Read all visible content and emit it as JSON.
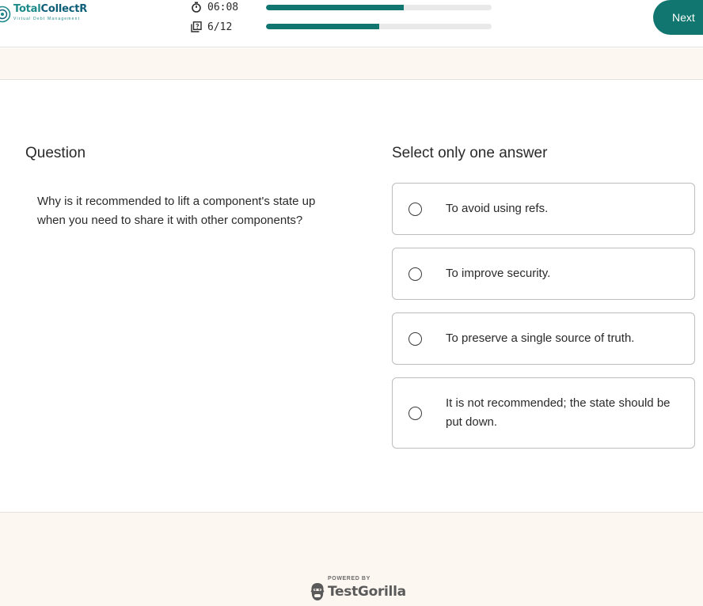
{
  "header": {
    "logo": {
      "name_part1": "Total",
      "name_part2": "CollectR",
      "tagline": "Virtual Debt Management"
    },
    "timer": {
      "icon": "stopwatch-icon",
      "value": "06:08",
      "progress": 0.61
    },
    "question_count": {
      "icon": "question-book-icon",
      "value": "6/12",
      "progress": 0.5
    },
    "next_label": "Next"
  },
  "question": {
    "heading": "Question",
    "text": "Why is it recommended to lift a component's state up when you need to share it with other components?"
  },
  "answers": {
    "heading": "Select only one answer",
    "options": [
      {
        "label": "To avoid using refs.",
        "selected": false
      },
      {
        "label": "To improve security.",
        "selected": false
      },
      {
        "label": "To preserve a single source of truth.",
        "selected": false
      },
      {
        "label": "It is not recommended; the state should be put down.",
        "selected": false
      }
    ]
  },
  "footer": {
    "powered_by": "POWERED BY",
    "brand": "TestGorilla",
    "brand_icon": "gorilla-icon"
  },
  "colors": {
    "accent": "#11766f",
    "band": "#fdf7f2",
    "track": "#e9e9e9"
  }
}
